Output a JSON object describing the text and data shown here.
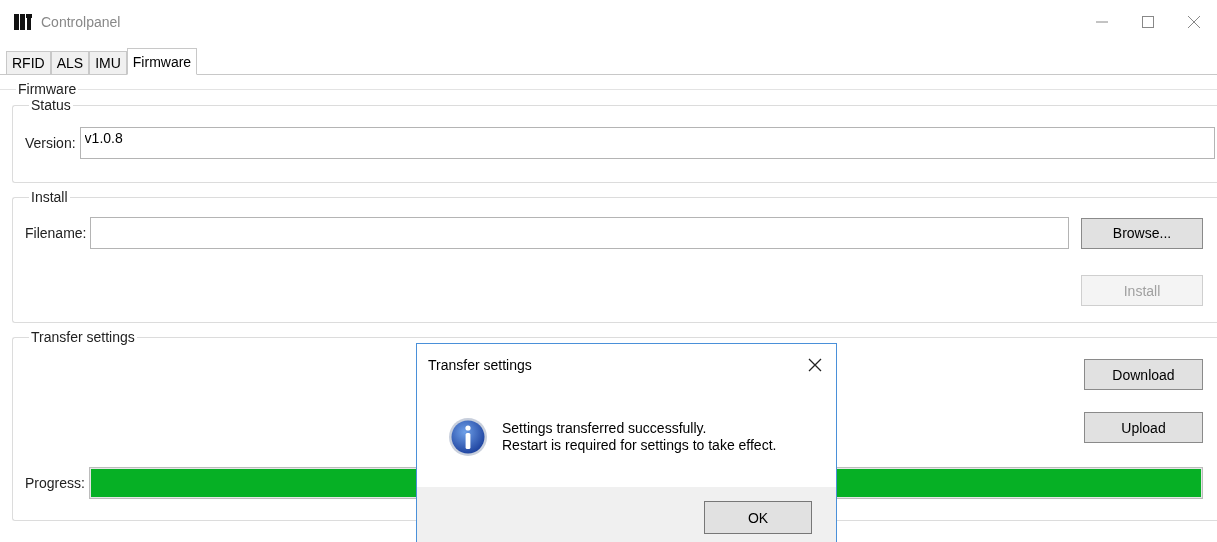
{
  "window": {
    "title": "Controlpanel"
  },
  "tabs": [
    {
      "label": "RFID",
      "selected": false
    },
    {
      "label": "ALS",
      "selected": false
    },
    {
      "label": "IMU",
      "selected": false
    },
    {
      "label": "Firmware",
      "selected": true
    }
  ],
  "firmware": {
    "title": "Firmware",
    "status": {
      "title": "Status",
      "version_label": "Version:",
      "version_value": "v1.0.8"
    },
    "install": {
      "title": "Install",
      "filename_label": "Filename:",
      "browse_button": "Browse...",
      "install_button": {
        "label": "Install",
        "disabled": true
      }
    },
    "transfer": {
      "title": "Transfer settings",
      "download_button": "Download",
      "upload_button": "Upload",
      "progress_label": "Progress:",
      "progress": {
        "level": 1
      }
    }
  },
  "dialog": {
    "title": "Transfer settings",
    "message": [
      "Settings transferred successfully.",
      "Restart is required for settings to take effect."
    ],
    "ok_button": "OK"
  }
}
